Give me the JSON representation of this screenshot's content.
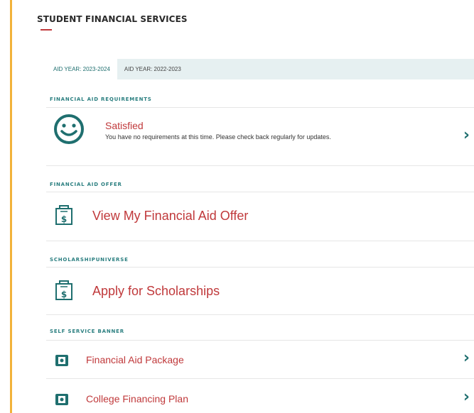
{
  "page": {
    "title": "STUDENT FINANCIAL SERVICES"
  },
  "tabs": [
    {
      "label": "AID YEAR: 2023-2024",
      "active": true
    },
    {
      "label": "AID YEAR: 2022-2023",
      "active": false
    }
  ],
  "sections": {
    "requirements": {
      "heading": "FINANCIAL AID REQUIREMENTS",
      "status": "Satisfied",
      "description": "You have no requirements at this time. Please check back regularly for updates.",
      "icon": "smiley-icon"
    },
    "offer": {
      "heading": "FINANCIAL AID OFFER",
      "link": "View My Financial Aid Offer",
      "icon": "money-document-icon"
    },
    "scholarships": {
      "heading": "SCHOLARSHIPUNIVERSE",
      "link": "Apply for Scholarships",
      "icon": "money-document-icon"
    },
    "banner": {
      "heading": "SELF SERVICE BANNER",
      "items": [
        {
          "label": "Financial Aid Package",
          "icon": "package-icon"
        },
        {
          "label": "College Financing Plan",
          "icon": "package-icon"
        }
      ]
    }
  },
  "colors": {
    "accent_red": "#c0393b",
    "accent_teal": "#1f6f6f",
    "heading_teal": "#2b7f80",
    "left_rule": "#f2b23a",
    "tab_bg": "#e6f0f1"
  }
}
